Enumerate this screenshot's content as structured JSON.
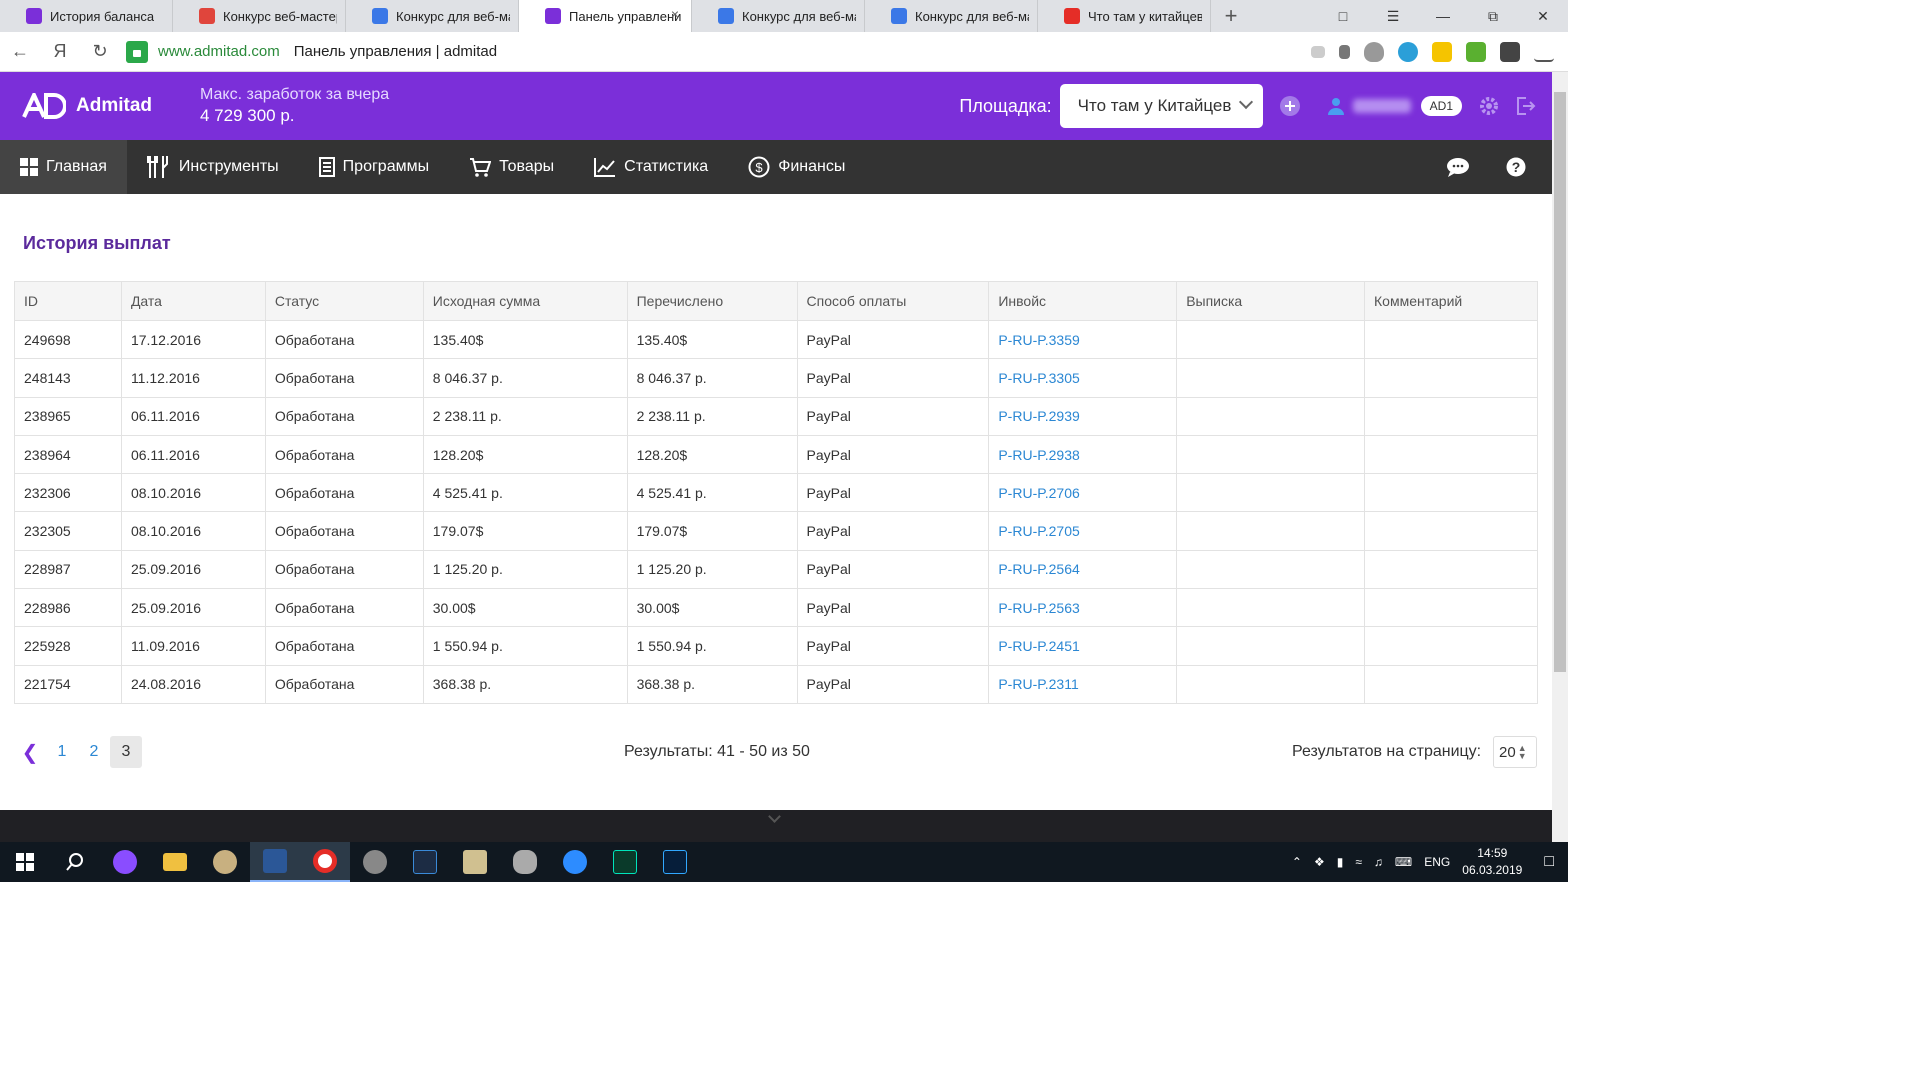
{
  "browser": {
    "tabs": [
      {
        "label": "История баланса",
        "color": "#7b2fd9",
        "active": false
      },
      {
        "label": "Конкурс веб-мастеро",
        "color": "#e0453c",
        "active": false
      },
      {
        "label": "Конкурс для веб-мас",
        "color": "#3b78e7",
        "active": false
      },
      {
        "label": "Панель управлени",
        "color": "#7b2fd9",
        "active": true
      },
      {
        "label": "Конкурс для веб-мас",
        "color": "#3b78e7",
        "active": false
      },
      {
        "label": "Конкурс для веб-мас",
        "color": "#3b78e7",
        "active": false
      },
      {
        "label": "Что там у китайцев",
        "color": "#e52d27",
        "active": false
      }
    ],
    "new_tab": "+",
    "close_tab": "×",
    "yandex_letter": "Я",
    "url_host": "www.admitad.com",
    "url_title": "Панель управления | admitad"
  },
  "header": {
    "brand": "Admitad",
    "earn_label": "Макс. заработок за вчера",
    "earn_value": "4 729 300 р.",
    "platform_label": "Площадка:",
    "platform_value": "Что там у Китайцев",
    "badge": "AD1"
  },
  "nav": {
    "items": [
      {
        "label": "Главная",
        "icon": "grid-icon",
        "active": true
      },
      {
        "label": "Инструменты",
        "icon": "tools-icon",
        "active": false
      },
      {
        "label": "Программы",
        "icon": "list-icon",
        "active": false
      },
      {
        "label": "Товары",
        "icon": "cart-icon",
        "active": false
      },
      {
        "label": "Статистика",
        "icon": "chart-icon",
        "active": false
      },
      {
        "label": "Финансы",
        "icon": "dollar-icon",
        "active": false
      }
    ]
  },
  "page": {
    "title": "История выплат",
    "columns": [
      "ID",
      "Дата",
      "Статус",
      "Исходная сумма",
      "Перечислено",
      "Способ оплаты",
      "Инвойс",
      "Выписка",
      "Комментарий"
    ],
    "rows": [
      [
        "249698",
        "17.12.2016",
        "Обработана",
        "135.40$",
        "135.40$",
        "PayPal",
        "P-RU-P.3359",
        "",
        ""
      ],
      [
        "248143",
        "11.12.2016",
        "Обработана",
        "8 046.37 р.",
        "8 046.37 р.",
        "PayPal",
        "P-RU-P.3305",
        "",
        ""
      ],
      [
        "238965",
        "06.11.2016",
        "Обработана",
        "2 238.11 р.",
        "2 238.11 р.",
        "PayPal",
        "P-RU-P.2939",
        "",
        ""
      ],
      [
        "238964",
        "06.11.2016",
        "Обработана",
        "128.20$",
        "128.20$",
        "PayPal",
        "P-RU-P.2938",
        "",
        ""
      ],
      [
        "232306",
        "08.10.2016",
        "Обработана",
        "4 525.41 р.",
        "4 525.41 р.",
        "PayPal",
        "P-RU-P.2706",
        "",
        ""
      ],
      [
        "232305",
        "08.10.2016",
        "Обработана",
        "179.07$",
        "179.07$",
        "PayPal",
        "P-RU-P.2705",
        "",
        ""
      ],
      [
        "228987",
        "25.09.2016",
        "Обработана",
        "1 125.20 р.",
        "1 125.20 р.",
        "PayPal",
        "P-RU-P.2564",
        "",
        ""
      ],
      [
        "228986",
        "25.09.2016",
        "Обработана",
        "30.00$",
        "30.00$",
        "PayPal",
        "P-RU-P.2563",
        "",
        ""
      ],
      [
        "225928",
        "11.09.2016",
        "Обработана",
        "1 550.94 р.",
        "1 550.94 р.",
        "PayPal",
        "P-RU-P.2451",
        "",
        ""
      ],
      [
        "221754",
        "24.08.2016",
        "Обработана",
        "368.38 р.",
        "368.38 р.",
        "PayPal",
        "P-RU-P.2311",
        "",
        ""
      ]
    ],
    "pager": {
      "pages": [
        "1",
        "2",
        "3"
      ],
      "current": "3"
    },
    "results_text": "Результаты: 41 - 50 из 50",
    "per_page_label": "Результатов на страницу:",
    "per_page_value": "20"
  },
  "taskbar": {
    "lang": "ENG",
    "time": "14:59",
    "date": "06.03.2019"
  },
  "colors": {
    "brand": "#7b2fd9",
    "nav_bg": "#333333",
    "link": "#2b87d3",
    "title": "#5b2a9c"
  }
}
